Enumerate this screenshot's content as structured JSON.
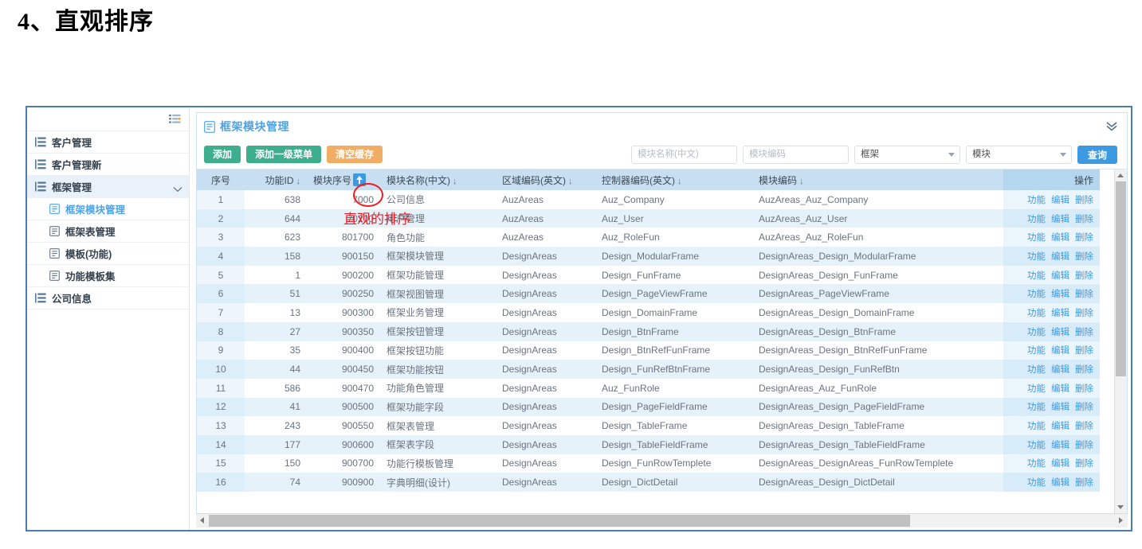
{
  "page": {
    "heading": "4、直观排序"
  },
  "sidebar": {
    "menu_icon": "list-menu-icon",
    "items": [
      {
        "label": "客户管理",
        "icon": "list-tree-icon",
        "type": "group",
        "expanded": false,
        "active": false
      },
      {
        "label": "客户管理新",
        "icon": "list-tree-icon",
        "type": "group",
        "expanded": false,
        "active": false
      },
      {
        "label": "框架管理",
        "icon": "list-tree-icon",
        "type": "group",
        "expanded": true,
        "active": true
      },
      {
        "label": "框架模块管理",
        "icon": "document-icon",
        "type": "child",
        "selected": true
      },
      {
        "label": "框架表管理",
        "icon": "document-icon",
        "type": "child",
        "selected": false
      },
      {
        "label": "模板(功能)",
        "icon": "document-icon",
        "type": "child",
        "selected": false
      },
      {
        "label": "功能模板集",
        "icon": "document-icon",
        "type": "child",
        "selected": false
      },
      {
        "label": "公司信息",
        "icon": "list-tree-icon",
        "type": "group",
        "expanded": false,
        "active": false
      }
    ]
  },
  "panel": {
    "title": "框架模块管理",
    "title_icon": "document-icon",
    "collapse_icon": "double-chevron-down-icon"
  },
  "toolbar": {
    "buttons": [
      {
        "label": "添加",
        "style": "green"
      },
      {
        "label": "添加一级菜单",
        "style": "green"
      },
      {
        "label": "清空缓存",
        "style": "orange"
      }
    ]
  },
  "filters": {
    "name_placeholder": "模块名称(中文)",
    "name_value": "",
    "code_placeholder": "模块编码",
    "code_value": "",
    "frame_select": "框架",
    "module_select": "模块",
    "search_label": "查询"
  },
  "table": {
    "columns": [
      {
        "key": "seq",
        "label": "序号",
        "sort": "",
        "active_sort": false
      },
      {
        "key": "funid",
        "label": "功能ID",
        "sort": "↓",
        "active_sort": false
      },
      {
        "key": "modseq",
        "label": "模块序号",
        "sort": "↑",
        "active_sort": true
      },
      {
        "key": "name",
        "label": "模块名称(中文)",
        "sort": "↓",
        "active_sort": false
      },
      {
        "key": "area",
        "label": "区域编码(英文)",
        "sort": "↓",
        "active_sort": false
      },
      {
        "key": "ctrl",
        "label": "控制器编码(英文)",
        "sort": "↓",
        "active_sort": false
      },
      {
        "key": "modcode",
        "label": "模块编码",
        "sort": "↓",
        "active_sort": false
      },
      {
        "key": "ops",
        "label": "操作",
        "sort": "",
        "active_sort": false
      }
    ],
    "op_links": [
      "功能",
      "编辑",
      "删除"
    ],
    "rows": [
      {
        "seq": "1",
        "funid": "638",
        "modseq": "7000",
        "name": "公司信息",
        "area": "AuzAreas",
        "ctrl": "Auz_Company",
        "modcode": "AuzAreas_Auz_Company"
      },
      {
        "seq": "2",
        "funid": "644",
        "modseq": "70200",
        "name": "用户管理",
        "area": "AuzAreas",
        "ctrl": "Auz_User",
        "modcode": "AuzAreas_Auz_User"
      },
      {
        "seq": "3",
        "funid": "623",
        "modseq": "801700",
        "name": "角色功能",
        "area": "AuzAreas",
        "ctrl": "Auz_RoleFun",
        "modcode": "AuzAreas_Auz_RoleFun"
      },
      {
        "seq": "4",
        "funid": "158",
        "modseq": "900150",
        "name": "框架模块管理",
        "area": "DesignAreas",
        "ctrl": "Design_ModularFrame",
        "modcode": "DesignAreas_Design_ModularFrame"
      },
      {
        "seq": "5",
        "funid": "1",
        "modseq": "900200",
        "name": "框架功能管理",
        "area": "DesignAreas",
        "ctrl": "Design_FunFrame",
        "modcode": "DesignAreas_Design_FunFrame"
      },
      {
        "seq": "6",
        "funid": "51",
        "modseq": "900250",
        "name": "框架视图管理",
        "area": "DesignAreas",
        "ctrl": "Design_PageViewFrame",
        "modcode": "DesignAreas_PageViewFrame"
      },
      {
        "seq": "7",
        "funid": "13",
        "modseq": "900300",
        "name": "框架业务管理",
        "area": "DesignAreas",
        "ctrl": "Design_DomainFrame",
        "modcode": "DesignAreas_Design_DomainFrame"
      },
      {
        "seq": "8",
        "funid": "27",
        "modseq": "900350",
        "name": "框架按钮管理",
        "area": "DesignAreas",
        "ctrl": "Design_BtnFrame",
        "modcode": "DesignAreas_Design_BtnFrame"
      },
      {
        "seq": "9",
        "funid": "35",
        "modseq": "900400",
        "name": "框架按钮功能",
        "area": "DesignAreas",
        "ctrl": "Design_BtnRefFunFrame",
        "modcode": "DesignAreas_Design_BtnRefFunFrame"
      },
      {
        "seq": "10",
        "funid": "44",
        "modseq": "900450",
        "name": "框架功能按钮",
        "area": "DesignAreas",
        "ctrl": "Design_FunRefBtnFrame",
        "modcode": "DesignAreas_Design_FunRefBtn"
      },
      {
        "seq": "11",
        "funid": "586",
        "modseq": "900470",
        "name": "功能角色管理",
        "area": "DesignAreas",
        "ctrl": "Auz_FunRole",
        "modcode": "DesignAreas_Auz_FunRole"
      },
      {
        "seq": "12",
        "funid": "41",
        "modseq": "900500",
        "name": "框架功能字段",
        "area": "DesignAreas",
        "ctrl": "Design_PageFieldFrame",
        "modcode": "DesignAreas_Design_PageFieldFrame"
      },
      {
        "seq": "13",
        "funid": "243",
        "modseq": "900550",
        "name": "框架表管理",
        "area": "DesignAreas",
        "ctrl": "Design_TableFrame",
        "modcode": "DesignAreas_Design_TableFrame"
      },
      {
        "seq": "14",
        "funid": "177",
        "modseq": "900600",
        "name": "框架表字段",
        "area": "DesignAreas",
        "ctrl": "Design_TableFieldFrame",
        "modcode": "DesignAreas_Design_TableFieldFrame"
      },
      {
        "seq": "15",
        "funid": "150",
        "modseq": "900700",
        "name": "功能行模板管理",
        "area": "DesignAreas",
        "ctrl": "Design_FunRowTemplete",
        "modcode": "DesignAreas_DesignAreas_FunRowTemplete"
      },
      {
        "seq": "16",
        "funid": "74",
        "modseq": "900900",
        "name": "字典明细(设计)",
        "area": "DesignAreas",
        "ctrl": "Design_DictDetail",
        "modcode": "DesignAreas_Design_DictDetail"
      }
    ]
  },
  "annotations": {
    "circle_target": "模块序号 sort button",
    "note_text": "直观的排序",
    "note_color": "#ee1c25"
  },
  "colors": {
    "accent_blue": "#3d9ae0",
    "header_blue": "#c7dff1",
    "green": "#3fae8f",
    "orange": "#f0ad63",
    "border_blue": "#4a7db5",
    "row_even": "#e6f2fa"
  }
}
